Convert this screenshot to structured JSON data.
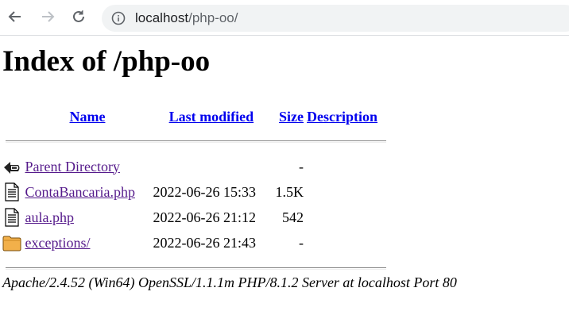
{
  "browser": {
    "url_host": "localhost",
    "url_path": "/php-oo/",
    "icons": [
      "back-arrow-icon",
      "forward-arrow-icon",
      "reload-icon",
      "info-icon"
    ]
  },
  "page": {
    "title": "Index of /php-oo",
    "headers": {
      "name": "Name",
      "last_modified": "Last modified",
      "size": "Size",
      "description": "Description"
    },
    "entries": [
      {
        "icon": "back-icon",
        "name": "Parent Directory",
        "modified": "",
        "size": "-",
        "description": ""
      },
      {
        "icon": "text-file-icon",
        "name": "ContaBancaria.php",
        "modified": "2022-06-26 15:33",
        "size": "1.5K",
        "description": ""
      },
      {
        "icon": "text-file-icon",
        "name": "aula.php",
        "modified": "2022-06-26 21:12",
        "size": "542",
        "description": ""
      },
      {
        "icon": "folder-icon",
        "name": "exceptions/",
        "modified": "2022-06-26 21:43",
        "size": "-",
        "description": ""
      }
    ],
    "footer": "Apache/2.4.52 (Win64) OpenSSL/1.1.1m PHP/8.1.2 Server at localhost Port 80"
  }
}
